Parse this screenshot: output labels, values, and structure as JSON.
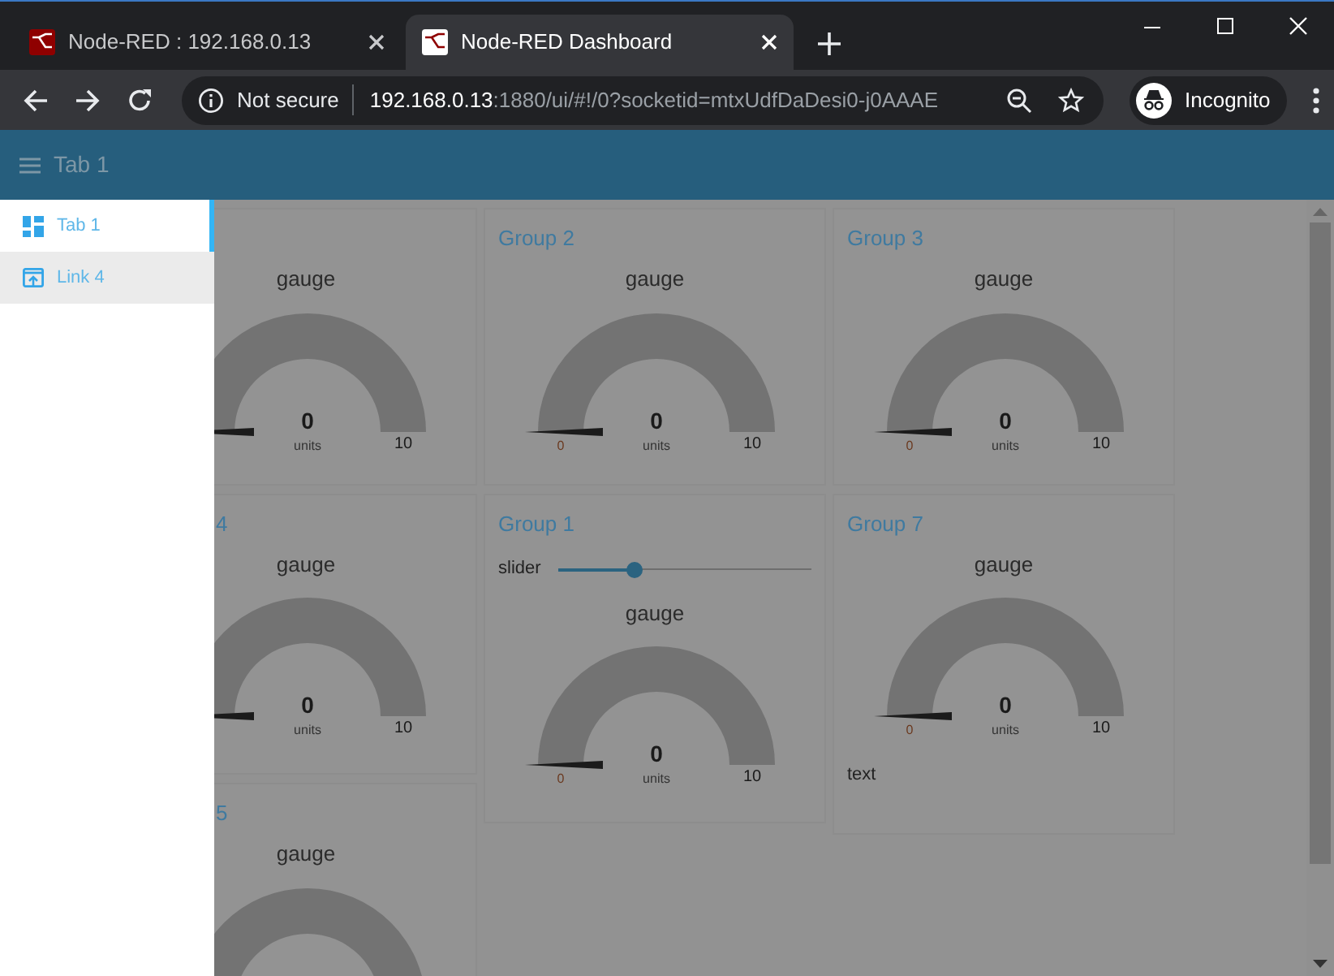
{
  "browser": {
    "tabs": [
      {
        "title": "Node-RED : 192.168.0.13",
        "selected": false
      },
      {
        "title": "Node-RED Dashboard",
        "selected": true
      }
    ],
    "address": {
      "security": "Not secure",
      "host": "192.168.0.13",
      "path": ":1880/ui/#!/0?socketid=mtxUdfDaDesi0-j0AAAE",
      "profile": "Incognito"
    }
  },
  "header": {
    "title": "Tab 1"
  },
  "sidebar": {
    "items": [
      {
        "label": "Tab 1",
        "kind": "tab",
        "selected": true
      },
      {
        "label": "Link 4",
        "kind": "link",
        "selected": false
      }
    ]
  },
  "columns": [
    [
      {
        "widgets": [
          {
            "kind": "gauge",
            "title": "gauge",
            "value": "0",
            "units": "units",
            "max": "10"
          }
        ]
      },
      {
        "title": "4",
        "widgets": [
          {
            "kind": "gauge",
            "title": "gauge",
            "value": "0",
            "units": "units",
            "max": "10"
          }
        ]
      },
      {
        "title": "5",
        "widgets": [
          {
            "kind": "gauge",
            "title": "gauge"
          }
        ]
      }
    ],
    [
      {
        "title": "Group 2",
        "widgets": [
          {
            "kind": "gauge",
            "title": "gauge",
            "value": "0",
            "units": "units",
            "min": "0",
            "max": "10"
          }
        ]
      },
      {
        "title": "Group 1",
        "widgets": [
          {
            "kind": "slider",
            "label": "slider",
            "level": 0.3
          },
          {
            "kind": "gauge",
            "title": "gauge",
            "value": "0",
            "units": "units",
            "min": "0",
            "max": "10"
          }
        ]
      }
    ],
    [
      {
        "title": "Group 3",
        "widgets": [
          {
            "kind": "gauge",
            "title": "gauge",
            "value": "0",
            "units": "units",
            "min": "0",
            "max": "10"
          }
        ]
      },
      {
        "title": "Group 7",
        "widgets": [
          {
            "kind": "gauge",
            "title": "gauge",
            "value": "0",
            "units": "units",
            "min": "0",
            "max": "10"
          },
          {
            "kind": "text",
            "label": "text"
          }
        ]
      }
    ]
  ]
}
